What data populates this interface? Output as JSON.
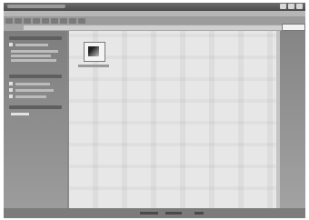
{
  "window": {
    "title": ""
  },
  "search": {
    "value": ""
  },
  "files": [
    {
      "name": ""
    }
  ],
  "icons": {
    "minimize": "minimize-icon",
    "maximize": "maximize-icon",
    "close": "close-icon",
    "file": "image-file-icon"
  },
  "colors": {
    "content_background": "#e7e7e7",
    "sidebar_background": "#8a8a8a",
    "title_bar": "#4a4a4a"
  }
}
